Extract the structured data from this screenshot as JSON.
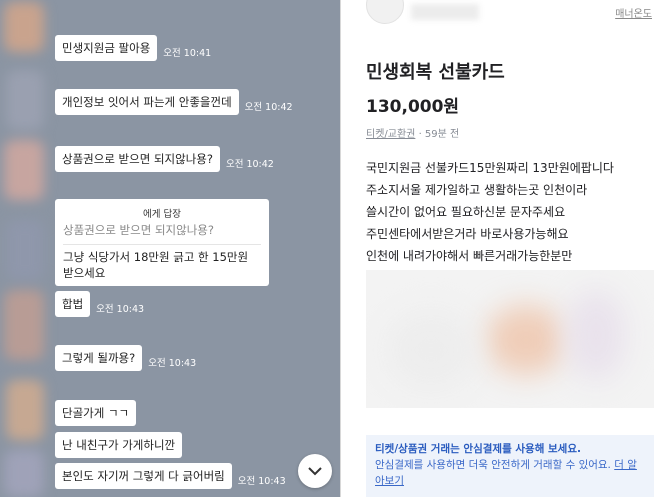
{
  "chat": {
    "messages": [
      {
        "text": "민생지원금 팔아용",
        "time": "오전 10:41"
      },
      {
        "text": "개인정보 잇어서 파는게 안좋을껀데",
        "time": "오전 10:42"
      },
      {
        "text": "상품권으로 받으면 되지않나용?",
        "time": "오전 10:42"
      },
      {
        "text": "합법",
        "time": "오전 10:43"
      },
      {
        "text": "그렇게 될까용?",
        "time": "오전 10:43"
      },
      {
        "text": "단골가게 ㄱㄱ"
      },
      {
        "text": "난 내친구가 가게하니깐"
      },
      {
        "text": "본인도 자기꺼 그렇게 다 긁어버림",
        "time": "오전 10:43"
      }
    ],
    "reply": {
      "to": "에게 답장",
      "quote": "상품권으로 받으면 되지않나용?",
      "line1": "그냥 식당가서 18만원 긁고 한 15만원",
      "line2": "받으세요"
    },
    "scroll_icon": "chevron-down-icon"
  },
  "listing": {
    "manner_label": "매너온도",
    "title": "민생회복 선불카드",
    "price": "130,000원",
    "category": "티켓/교환권",
    "time_ago": "59분 전",
    "description": [
      "국민지원금 선불카드15만원짜리 13만원에팝니다",
      "주소지서울 제가일하고 생활하는곳 인천이라",
      "쓸시간이 없어요 필요하신분 문자주세요",
      "주민센타에서받은거라  바로사용가능해요",
      "인천에 내려가야해서 빠른거래가능한분만"
    ],
    "notice": {
      "title": "티켓/상품권 거래는 안심결제를 사용해 보세요.",
      "body": "안심결제를 사용하면 더욱 안전하게 거래할 수 있어요.",
      "link": "더 알아보기"
    }
  }
}
